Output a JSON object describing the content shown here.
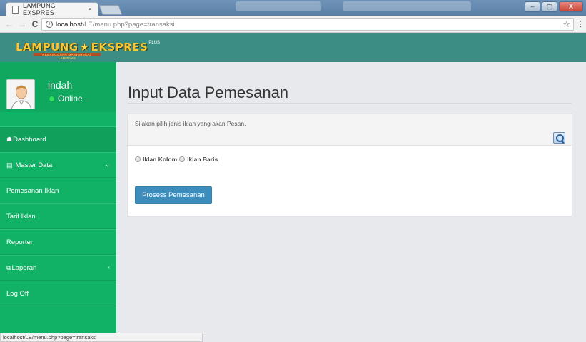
{
  "browser": {
    "tab_title": "LAMPUNG EXSPRES",
    "tab_close": "×",
    "url_host": "localhost",
    "url_path": "/LE/menu.php?page=transaksi",
    "status_url": "localhost/LE/menu.php?page=transaksi",
    "icons": {
      "back": "←",
      "forward": "→",
      "reload": "C",
      "info": "i",
      "star": "☆",
      "menu": "⋮",
      "minimize": "–",
      "maximize": "▢",
      "close": "X"
    }
  },
  "header": {
    "logo_left": "LAMPUNG",
    "logo_star": "★",
    "logo_right": "EKSPRES",
    "logo_plus": "PLUS",
    "logo_tagline": "KEBANGGAAN MASYARAKAT LAMPUNG",
    "brand_color": "#3c8e84"
  },
  "sidebar": {
    "user": {
      "name": "indah",
      "status": "Online"
    },
    "items": [
      {
        "label": "Dashboard",
        "icon": "☗",
        "caret": ""
      },
      {
        "label": "Master Data",
        "icon": "▤",
        "caret": "⌄"
      },
      {
        "label": "Pemesanan Iklan",
        "icon": "",
        "caret": ""
      },
      {
        "label": "Tarif Iklan",
        "icon": "",
        "caret": ""
      },
      {
        "label": "Reporter",
        "icon": "",
        "caret": ""
      },
      {
        "label": "Laporan",
        "icon": "⧉",
        "caret": "‹"
      },
      {
        "label": "Log Off",
        "icon": "",
        "caret": ""
      }
    ],
    "color": "#12b266"
  },
  "main": {
    "title": "Input Data Pemesanan",
    "hint": "Silakan pilih jenis iklan yang akan Pesan.",
    "options": [
      "Iklan Kolom",
      "Iklan Baris"
    ],
    "submit_label": "Prosess Pemesanan",
    "button_color": "#3c8dbc"
  }
}
